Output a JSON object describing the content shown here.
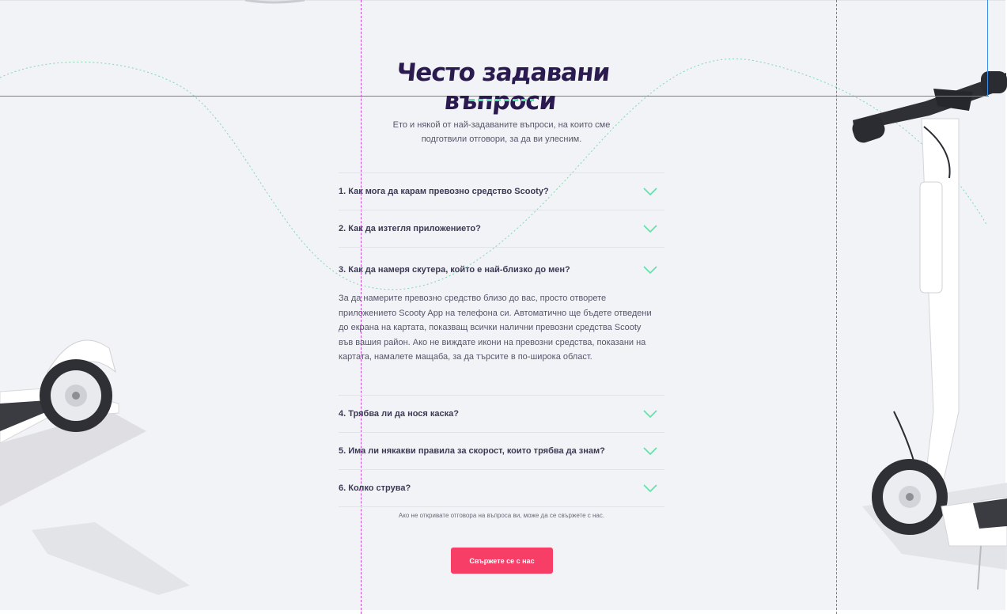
{
  "faq": {
    "title": "Често задавани въпроси",
    "intro_line1": "Ето и някой от най-задаваните въпроси, на които сме",
    "intro_line2": "подготвили отговори, за да ви улесним.",
    "items": [
      {
        "question": "1. Как мога да карам превозно средство Scooty?"
      },
      {
        "question": "2. Как да изтегля приложението?"
      },
      {
        "question": "3. Как да намеря скутера, който е най-близко до мен?",
        "answer_lines": [
          "За да намерите превозно средство близо до вас, просто отворете",
          "приложението Scooty App на телефона си. Автоматично ще бъдете отведени",
          "до екрана на картата, показващ всички налични превозни средства Scooty",
          "във вашия район. Ако не виждате икони на превозни средства, показани на",
          "картата, намалете мащаба, за да търсите в по-широка област."
        ]
      },
      {
        "question": "4. Трябва ли да нося каска?"
      },
      {
        "question": "5. Има ли някакви правила за скорост, които трябва да знам?"
      },
      {
        "question": "6. Колко струва?"
      }
    ],
    "note": "Ако не откривате отговора на въпроса ви, може да се свържете с нас.",
    "cta_label": "Свържете се с нас"
  },
  "colors": {
    "background": "#f2f3f6",
    "accent_green": "#5be3a6",
    "cta_pink": "#f73e66",
    "title_dark": "#2a1a4f"
  },
  "icons": {
    "chevron": "chevron-down-icon",
    "scooter_left": "scooter-rear-wheel-image",
    "scooter_right": "scooter-image"
  }
}
